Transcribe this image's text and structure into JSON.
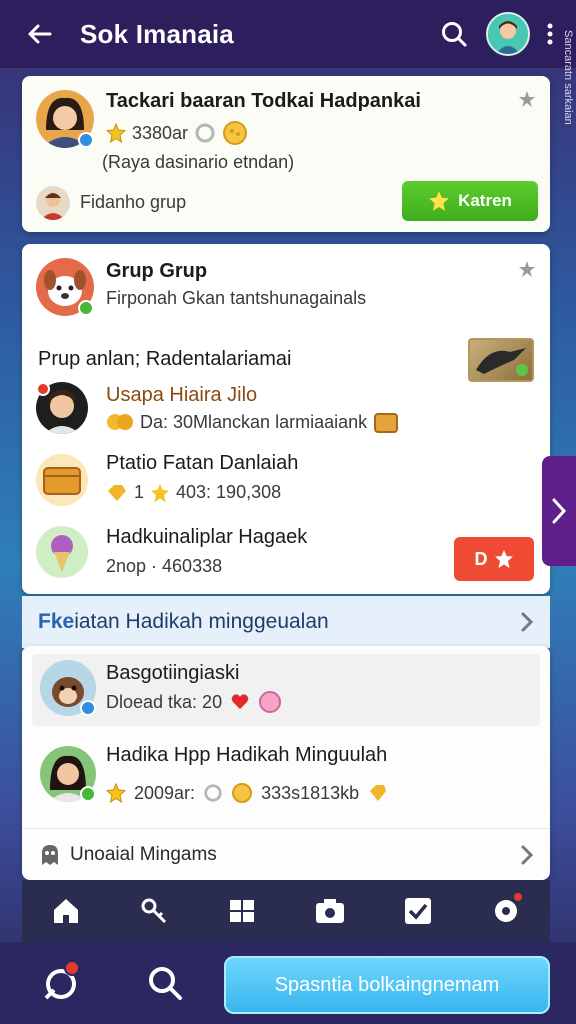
{
  "header": {
    "title": "Sok Imanaia"
  },
  "side_caption": "Sancaratn sarkaian",
  "card1": {
    "name": "Tackari baaran Todkai Hadpankai",
    "stat": "3380ar",
    "status": "(Raya dasinario etndan)",
    "footer": "Fidanho grup",
    "button": "Katren"
  },
  "card2": {
    "title": "Grup Grup",
    "subtitle": "Firponah Gkan tantshunagainals",
    "section": "Prup anlan; Radentalariamai",
    "items": [
      {
        "name": "Usapa Hiaira Jilo",
        "meta": "Da: 30Mlanckan larmiaaiank"
      },
      {
        "name": "Ptatio Fatan Danlaiah",
        "meta_num": "1",
        "meta": "403: 190,308"
      },
      {
        "name": "Hadkuinaliplar Hagaek",
        "meta": "2nop · 460338",
        "button": "D"
      }
    ]
  },
  "section_bar": {
    "prefix": "Fke",
    "label": "iatan Hadikah minggeualan"
  },
  "card3": {
    "items": [
      {
        "name": "Basgotiingiaski",
        "meta": "Dloead tka: 20"
      },
      {
        "name": "Hadika Hpp Hadikah Minguulah",
        "stat1": "2009ar:",
        "stat2": "333s1813kb"
      }
    ],
    "footer": "Unoaial Mingams"
  },
  "bottom_nav": {
    "items": [
      "home-icon",
      "key-icon",
      "grid-icon",
      "camera-icon",
      "check-icon",
      "settings-icon"
    ]
  },
  "action_bar": {
    "cta": "Spasntia bolkaingnemam"
  },
  "colors": {
    "header_bg": "#2d1f5e",
    "accent_green": "#4abb22",
    "accent_red": "#ef4b34",
    "cta_blue": "#38b4ee"
  }
}
